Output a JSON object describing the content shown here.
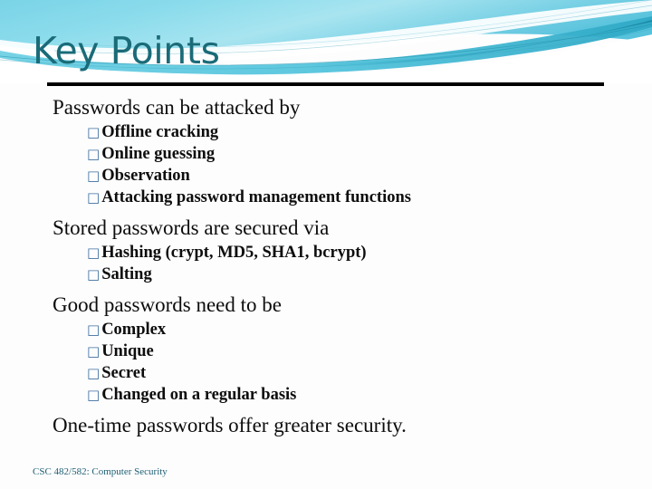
{
  "slide": {
    "title": "Key Points",
    "theme_accent": "#1a6b78",
    "banner_colors": {
      "cyan_light": "#8fdcea",
      "cyan": "#6bcde2",
      "teal": "#3fb8cf",
      "teal_dark": "#1b8fa8",
      "white": "#ffffff"
    },
    "rule_color": "#000000",
    "bullet_glyph": "□",
    "bullet_color": "#3f6f9f",
    "body": [
      {
        "heading": "Passwords can be attacked by",
        "items": [
          "Offline cracking",
          "Online guessing",
          "Observation",
          "Attacking password management functions"
        ]
      },
      {
        "heading": "Stored passwords are secured via",
        "items": [
          "Hashing (crypt, MD5, SHA1, bcrypt)",
          "Salting"
        ]
      },
      {
        "heading": "Good passwords need to be",
        "items": [
          "Complex",
          "Unique",
          "Secret",
          "Changed on a regular basis"
        ]
      },
      {
        "heading": "One-time passwords offer greater security.",
        "items": []
      }
    ],
    "footer": "CSC 482/582: Computer Security"
  }
}
